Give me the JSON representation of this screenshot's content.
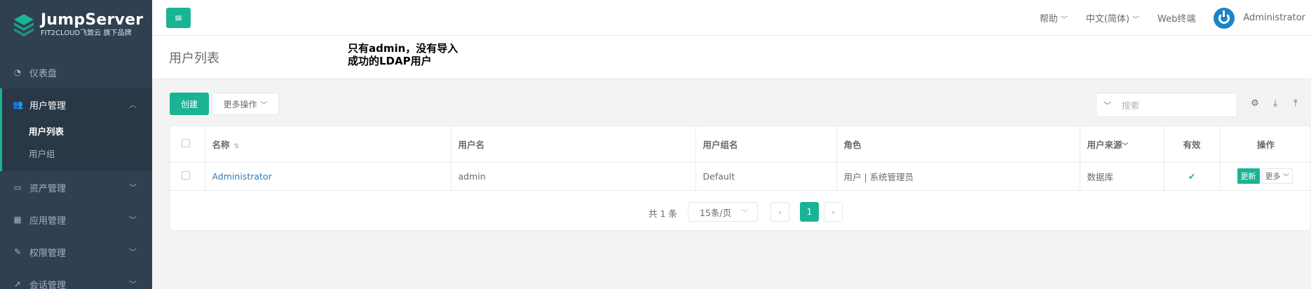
{
  "brand": {
    "title": "JumpServer",
    "subtitle": "FIT2CLOUD飞致云 旗下品牌",
    "accent": "#1ab394",
    "sidebar_bg": "#2f4050"
  },
  "sidebar": {
    "items": [
      {
        "label": "仪表盘",
        "icon": "dashboard-icon"
      },
      {
        "label": "用户管理",
        "icon": "users-icon",
        "active": true,
        "children": [
          "用户列表",
          "用户组"
        ]
      },
      {
        "label": "资产管理",
        "icon": "inbox-icon"
      },
      {
        "label": "应用管理",
        "icon": "grid-icon"
      },
      {
        "label": "权限管理",
        "icon": "edit-icon"
      },
      {
        "label": "会话管理",
        "icon": "rocket-icon"
      }
    ]
  },
  "topbar": {
    "help": "帮助",
    "language": "中文(简体)",
    "web_terminal": "Web终端",
    "user": "Administrator"
  },
  "page": {
    "title": "用户列表",
    "annotation": "只有admin，没有导入成功的LDAP用户"
  },
  "toolbar": {
    "create": "创建",
    "more_actions": "更多操作",
    "search_placeholder": "搜索"
  },
  "table": {
    "headers": [
      "名称",
      "用户名",
      "用户组名",
      "角色",
      "用户来源",
      "有效",
      "操作"
    ],
    "rows": [
      {
        "name": "Administrator",
        "username": "admin",
        "group": "Default",
        "role": "用户 | 系统管理员",
        "source": "数据库",
        "valid": "✔",
        "update": "更新",
        "more": "更多"
      }
    ]
  },
  "pagination": {
    "total": "共 1 条",
    "page_size": "15条/页",
    "current": "1"
  }
}
